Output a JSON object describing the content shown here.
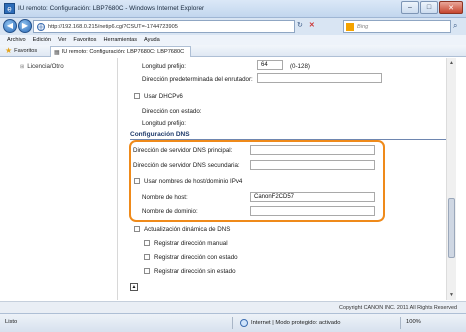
{
  "window": {
    "title": "IU remoto: Configuración: LBP7680C - Windows Internet Explorer",
    "min": "–",
    "max": "□",
    "close": "✕"
  },
  "address": {
    "url": "http://192.168.0.215/netip6.cgi?CSUT=-1744723905",
    "refresh": "↻",
    "stop": "✕",
    "search_placeholder": "Bing",
    "search_btn": "⌕",
    "back": "◀",
    "forward": "▶"
  },
  "menu": [
    "Archivo",
    "Edición",
    "Ver",
    "Favoritos",
    "Herramientas",
    "Ayuda"
  ],
  "favorites": {
    "label": "Favoritos",
    "tab_label": "IU remoto: Configuración: LBP7680C: LBP7680C"
  },
  "sidebar": {
    "item": "Licencia/Otro"
  },
  "ipv6": {
    "prefix_label": "Longitud prefijo:",
    "prefix_value": "64",
    "prefix_range": "(0-128)",
    "router_label": "Dirección predeterminada del enrutador:",
    "dhcp_label": "Usar DHCPv6",
    "state_addr_label": "Dirección con estado:",
    "prefix2_label": "Longitud prefijo:"
  },
  "dns": {
    "heading": "Configuración DNS",
    "primary_label": "Dirección de servidor DNS principal:",
    "secondary_label": "Dirección de servidor DNS secundaria:",
    "use_ipv4_label": "Usar nombres de host/dominio IPv4",
    "host_label": "Nombre de host:",
    "host_value": "CanonF2CD57",
    "domain_label": "Nombre de dominio:",
    "dynamic_label": "Actualización dinámica de DNS",
    "manual_label": "Registrar dirección manual",
    "stateful_label": "Registrar dirección con estado",
    "stateless_label": "Registrar dirección sin estado"
  },
  "footer": {
    "copyright": "Copyright CANON INC. 2011 All Rights Reserved"
  },
  "status": {
    "text": "Listo",
    "zone": "Internet | Modo protegido: activado",
    "zoom": "100%"
  },
  "colors": {
    "highlight": "#ef8a1a",
    "section": "#1f3b6b"
  }
}
